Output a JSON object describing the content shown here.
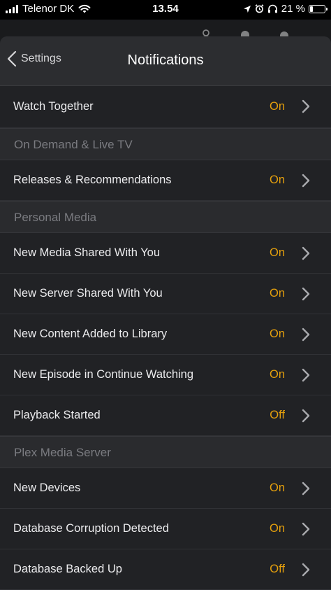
{
  "status_bar": {
    "carrier": "Telenor DK",
    "time": "13.54",
    "battery_percent": "21 %",
    "battery_level": 0.21
  },
  "navigation": {
    "back_label": "Settings",
    "title": "Notifications"
  },
  "colors": {
    "accent_on_off": "#e5a00d",
    "background": "#212225",
    "section_header_text": "#7a7b80"
  },
  "rows": {
    "watch_together": {
      "label": "Watch Together",
      "value": "On"
    }
  },
  "sections": [
    {
      "header": "On Demand & Live TV",
      "items": [
        {
          "label": "Releases & Recommendations",
          "value": "On"
        }
      ]
    },
    {
      "header": "Personal Media",
      "items": [
        {
          "label": "New Media Shared With You",
          "value": "On"
        },
        {
          "label": "New Server Shared With You",
          "value": "On"
        },
        {
          "label": "New Content Added to Library",
          "value": "On"
        },
        {
          "label": "New Episode in Continue Watching",
          "value": "On"
        },
        {
          "label": "Playback Started",
          "value": "Off"
        }
      ]
    },
    {
      "header": "Plex Media Server",
      "items": [
        {
          "label": "New Devices",
          "value": "On"
        },
        {
          "label": "Database Corruption Detected",
          "value": "On"
        },
        {
          "label": "Database Backed Up",
          "value": "Off"
        }
      ]
    }
  ],
  "icons": {
    "wifi": "wifi-icon",
    "location": "location-arrow-icon",
    "alarm": "alarm-clock-icon",
    "headphones": "headphones-icon",
    "chevron": "chevron-right-icon",
    "back": "chevron-left-icon"
  }
}
